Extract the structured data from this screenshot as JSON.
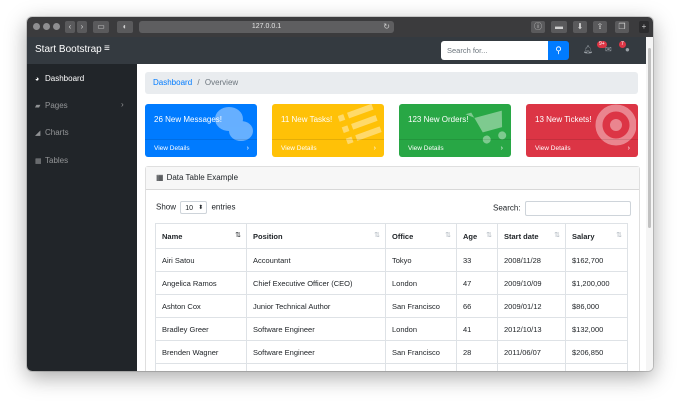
{
  "browser": {
    "url": "127.0.0.1"
  },
  "navbar": {
    "brand": "Start Bootstrap",
    "search_placeholder": "Search for...",
    "alerts_badge": "9+",
    "messages_badge": "7"
  },
  "sidebar": {
    "items": [
      {
        "label": "Dashboard",
        "icon": "tachometer-icon"
      },
      {
        "label": "Pages",
        "icon": "folder-icon"
      },
      {
        "label": "Charts",
        "icon": "area-chart-icon"
      },
      {
        "label": "Tables",
        "icon": "table-icon"
      }
    ]
  },
  "breadcrumb": {
    "link": "Dashboard",
    "separator": "/",
    "current": "Overview"
  },
  "cards": [
    {
      "title": "26 New Messages!",
      "footer": "View Details",
      "color": "#007bff",
      "icon": "comments-icon"
    },
    {
      "title": "11 New Tasks!",
      "footer": "View Details",
      "color": "#ffc107",
      "icon": "list-icon"
    },
    {
      "title": "123 New Orders!",
      "footer": "View Details",
      "color": "#28a745",
      "icon": "shopping-cart-icon"
    },
    {
      "title": "13 New Tickets!",
      "footer": "View Details",
      "color": "#dc3545",
      "icon": "life-ring-icon"
    }
  ],
  "datatable": {
    "header": "Data Table Example",
    "show_label": "Show",
    "entries_value": "10",
    "entries_label": "entries",
    "search_label": "Search:",
    "columns": [
      "Name",
      "Position",
      "Office",
      "Age",
      "Start date",
      "Salary"
    ],
    "rows": [
      [
        "Airi Satou",
        "Accountant",
        "Tokyo",
        "33",
        "2008/11/28",
        "$162,700"
      ],
      [
        "Angelica Ramos",
        "Chief Executive Officer (CEO)",
        "London",
        "47",
        "2009/10/09",
        "$1,200,000"
      ],
      [
        "Ashton Cox",
        "Junior Technical Author",
        "San Francisco",
        "66",
        "2009/01/12",
        "$86,000"
      ],
      [
        "Bradley Greer",
        "Software Engineer",
        "London",
        "41",
        "2012/10/13",
        "$132,000"
      ],
      [
        "Brenden Wagner",
        "Software Engineer",
        "San Francisco",
        "28",
        "2011/06/07",
        "$206,850"
      ],
      [
        "",
        "",
        "",
        "",
        "",
        ""
      ]
    ]
  }
}
